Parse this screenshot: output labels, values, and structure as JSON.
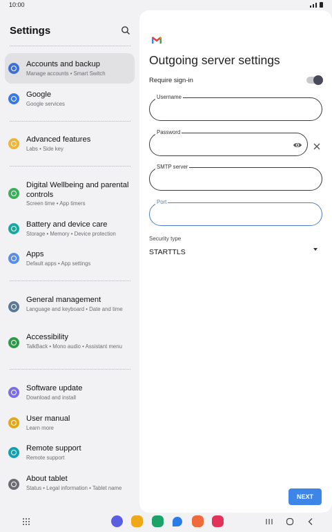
{
  "status": {
    "time": "10:00"
  },
  "settings": {
    "title": "Settings",
    "items": [
      {
        "title": "Accounts and backup",
        "sub": "Manage accounts  •  Smart Switch",
        "color": "#3d6fd8"
      },
      {
        "title": "Google",
        "sub": "Google services",
        "color": "#3a78e6"
      },
      {
        "title": "Advanced features",
        "sub": "Labs  •  Side key",
        "color": "#f0b33a"
      },
      {
        "title": "Digital Wellbeing and parental controls",
        "sub": "Screen time  •  App timers",
        "color": "#3cae5c"
      },
      {
        "title": "Battery and device care",
        "sub": "Storage  •  Memory  •  Device protection",
        "color": "#17a9a0"
      },
      {
        "title": "Apps",
        "sub": "Default apps  •  App settings",
        "color": "#5b8de8"
      },
      {
        "title": "General management",
        "sub": "Language and keyboard  •  Date and time",
        "color": "#5c7a96"
      },
      {
        "title": "Accessibility",
        "sub": "TalkBack  •  Mono audio  •  Assistant menu",
        "color": "#2d9a4a"
      },
      {
        "title": "Software update",
        "sub": "Download and install",
        "color": "#7a6ee0"
      },
      {
        "title": "User manual",
        "sub": "Learn more",
        "color": "#e3a81a"
      },
      {
        "title": "Remote support",
        "sub": "Remote support",
        "color": "#12a0b4"
      },
      {
        "title": "About tablet",
        "sub": "Status  •  Legal information  •  Tablet name",
        "color": "#6c6c72"
      }
    ]
  },
  "server": {
    "title": "Outgoing server settings",
    "require_signin": "Require sign-in",
    "require_signin_on": true,
    "username_label": "Username",
    "username_value": "",
    "password_label": "Password",
    "password_value": "",
    "smtp_label": "SMTP server",
    "smtp_value": "",
    "port_label": "Port",
    "port_value": "",
    "security_label": "Security type",
    "security_value": "STARTTLS",
    "next": "NEXT"
  },
  "colors": {
    "accent": "#3d86e8",
    "focus": "#4c7fbf"
  },
  "dock": [
    {
      "icon": "bixby-icon",
      "color": "#5a5ee0"
    },
    {
      "icon": "my-files-icon",
      "color": "#f0a818"
    },
    {
      "icon": "phone-icon",
      "color": "#1ba36a"
    },
    {
      "icon": "messages-icon",
      "color": "#2a7ce8"
    },
    {
      "icon": "contacts-icon",
      "color": "#f06a3c"
    },
    {
      "icon": "youtube-icon",
      "color": "#e3325a"
    }
  ]
}
